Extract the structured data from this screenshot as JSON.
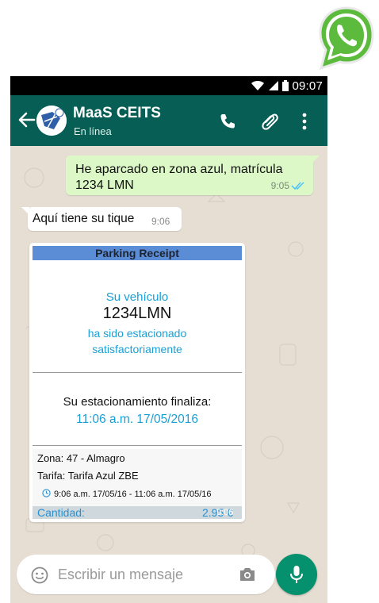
{
  "status_bar": {
    "time": "09:07"
  },
  "header": {
    "contact_name": "MaaS CEITS",
    "contact_status": "En línea",
    "avatar_text": "ITS"
  },
  "messages": [
    {
      "direction": "outgoing",
      "text": "He aparcado en zona azul, matrícula 1234 LMN",
      "time": "9:05",
      "status": "read"
    },
    {
      "direction": "incoming",
      "text": "Aquí tiene su tique",
      "time": "9:06"
    }
  ],
  "receipt": {
    "title": "Parking Receipt",
    "line1": "Su vehículo",
    "plate": "1234LMN",
    "line2": "ha sido estacionado",
    "line3": "satisfactoriamente",
    "ends_label": "Su estacionamiento  finaliza:",
    "ends_value": "11:06 a.m. 17/05/2016",
    "zona": "Zona: 47 - Almagro",
    "tarifa": "Tarifa: Tarifa Azul ZBE",
    "period": "9:06 a.m. 17/05/16 - 11:06 a.m. 17/05/16",
    "cantidad_label": "Cantidad:",
    "cantidad_value": "2.95 €",
    "overlay_time": "9:06"
  },
  "composer": {
    "placeholder": "Escribir un mensaje"
  },
  "colors": {
    "header": "#075e54",
    "outgoing_bubble": "#dcf8c6",
    "mic_button": "#05906e",
    "receipt_header": "#5b8cd6",
    "receipt_blue_text": "#1aa0d6"
  },
  "icons": [
    "whatsapp-logo",
    "wifi-icon",
    "signal-icon",
    "battery-icon",
    "back-arrow-icon",
    "phone-icon",
    "paperclip-icon",
    "more-vert-icon",
    "double-check-icon",
    "clock-icon",
    "emoji-icon",
    "camera-icon",
    "mic-icon"
  ]
}
